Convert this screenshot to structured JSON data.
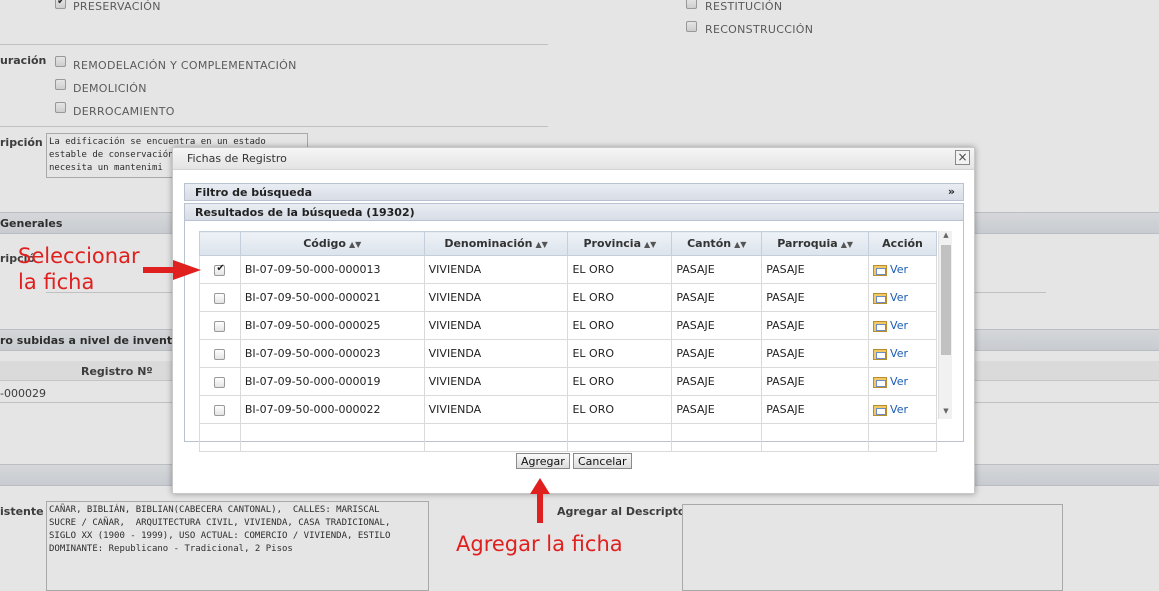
{
  "background": {
    "checkboxes_top": [
      {
        "label": "PRESERVACIÓN",
        "checked": true
      },
      {
        "label": "RESTITUCIÓN",
        "checked": false
      },
      {
        "label": "RECONSTRUCCIÓN",
        "checked": false
      }
    ],
    "label_configuracion": "uración",
    "checkboxes_mid": [
      {
        "label": "REMODELACIÓN Y COMPLEMENTACIÓN",
        "checked": false
      },
      {
        "label": "DEMOLICIÓN",
        "checked": false
      },
      {
        "label": "DERROCAMIENTO",
        "checked": false
      }
    ],
    "label_descripcion": "ripción",
    "descripcion_text": "La edificación se encuentra en un estado\nestable de conservación\nnecesita un mantenimi",
    "section_generales": "Generales",
    "label_descripcion2": "ripció",
    "section_inventario": "ro subidas a nivel de inventario",
    "col_registro": "Registro Nº",
    "registro_value": "-000029",
    "label_existente": "istente",
    "existente_text": "CAÑAR, BIBLIÁN, BIBLIAN(CABECERA CANTONAL),  CALLES: MARISCAL\nSUCRE / CAÑAR,  ARQUITECTURA CIVIL, VIVIENDA, CASA TRADICIONAL,\nSIGLO XX (1900 - 1999), USO ACTUAL: COMERCIO / VIVIENDA, ESTILO\nDOMINANTE: Republicano - Tradicional, 2 Pisos",
    "label_agregar_descriptor": "Agregar al Descriptor"
  },
  "dialog": {
    "title": "Fichas de Registro",
    "close_glyph": "×",
    "filter_header": "Filtro de búsqueda",
    "filter_chevron": "»",
    "results_header": "Resultados de la búsqueda (19302)",
    "columns": [
      "Código",
      "Denominación",
      "Provincia",
      "Cantón",
      "Parroquia",
      "Acción"
    ],
    "sort_glyph": "▲▼",
    "rows": [
      {
        "checked": true,
        "codigo": "BI-07-09-50-000-000013",
        "denominacion": "VIVIENDA",
        "provincia": "EL ORO",
        "canton": "PASAJE",
        "parroquia": "PASAJE",
        "accion": "Ver"
      },
      {
        "checked": false,
        "codigo": "BI-07-09-50-000-000021",
        "denominacion": "VIVIENDA",
        "provincia": "EL ORO",
        "canton": "PASAJE",
        "parroquia": "PASAJE",
        "accion": "Ver"
      },
      {
        "checked": false,
        "codigo": "BI-07-09-50-000-000025",
        "denominacion": "VIVIENDA",
        "provincia": "EL ORO",
        "canton": "PASAJE",
        "parroquia": "PASAJE",
        "accion": "Ver"
      },
      {
        "checked": false,
        "codigo": "BI-07-09-50-000-000023",
        "denominacion": "VIVIENDA",
        "provincia": "EL ORO",
        "canton": "PASAJE",
        "parroquia": "PASAJE",
        "accion": "Ver"
      },
      {
        "checked": false,
        "codigo": "BI-07-09-50-000-000019",
        "denominacion": "VIVIENDA",
        "provincia": "EL ORO",
        "canton": "PASAJE",
        "parroquia": "PASAJE",
        "accion": "Ver"
      },
      {
        "checked": false,
        "codigo": "BI-07-09-50-000-000022",
        "denominacion": "VIVIENDA",
        "provincia": "EL ORO",
        "canton": "PASAJE",
        "parroquia": "PASAJE",
        "accion": "Ver"
      }
    ],
    "agregar_label": "Agregar",
    "cancelar_label": "Cancelar"
  },
  "annotations": {
    "select_line1": "Seleccionar",
    "select_line2": "la ficha",
    "add_label": "Agregar la ficha",
    "color": "#e0201e"
  }
}
